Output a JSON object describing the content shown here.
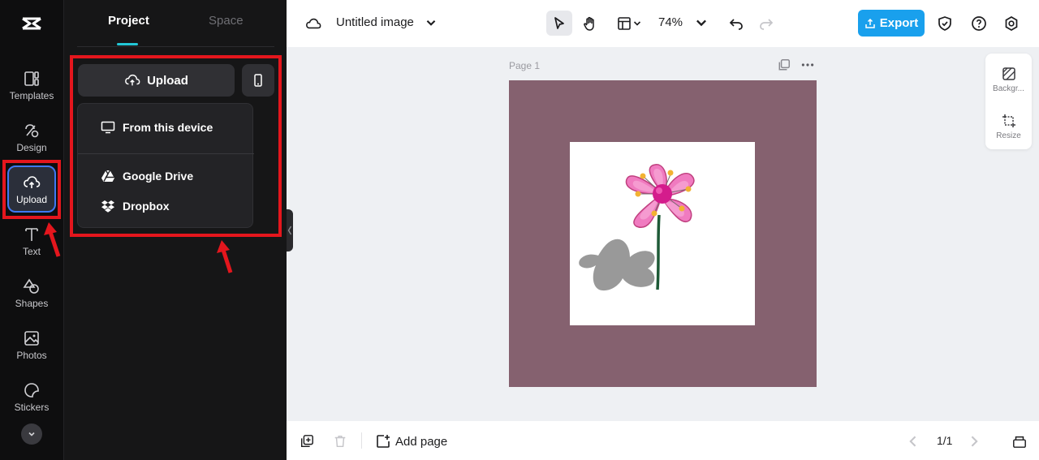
{
  "rail": {
    "items": [
      {
        "label": "Templates",
        "icon": "templates-icon"
      },
      {
        "label": "Design",
        "icon": "design-icon"
      },
      {
        "label": "Upload",
        "icon": "upload-cloud-icon",
        "active": true
      },
      {
        "label": "Text",
        "icon": "text-icon"
      },
      {
        "label": "Shapes",
        "icon": "shapes-icon"
      },
      {
        "label": "Photos",
        "icon": "photos-icon"
      },
      {
        "label": "Stickers",
        "icon": "stickers-icon"
      }
    ]
  },
  "panel": {
    "tabs": {
      "project": "Project",
      "space": "Space"
    },
    "upload_button": "Upload",
    "dropdown": {
      "from_device": "From this device",
      "google_drive": "Google Drive",
      "dropbox": "Dropbox"
    }
  },
  "topbar": {
    "doc_title": "Untitled image",
    "zoom": "74%",
    "export": "Export"
  },
  "canvas": {
    "page_label": "Page 1",
    "artboard_color": "#85616f"
  },
  "side_tools": {
    "background": "Backgr...",
    "resize": "Resize"
  },
  "bottombar": {
    "add_page": "Add page",
    "pager": "1/1"
  },
  "colors": {
    "accent": "#19a0ed",
    "highlight": "#e4161d",
    "tab_indicator": "#22c7d6"
  }
}
